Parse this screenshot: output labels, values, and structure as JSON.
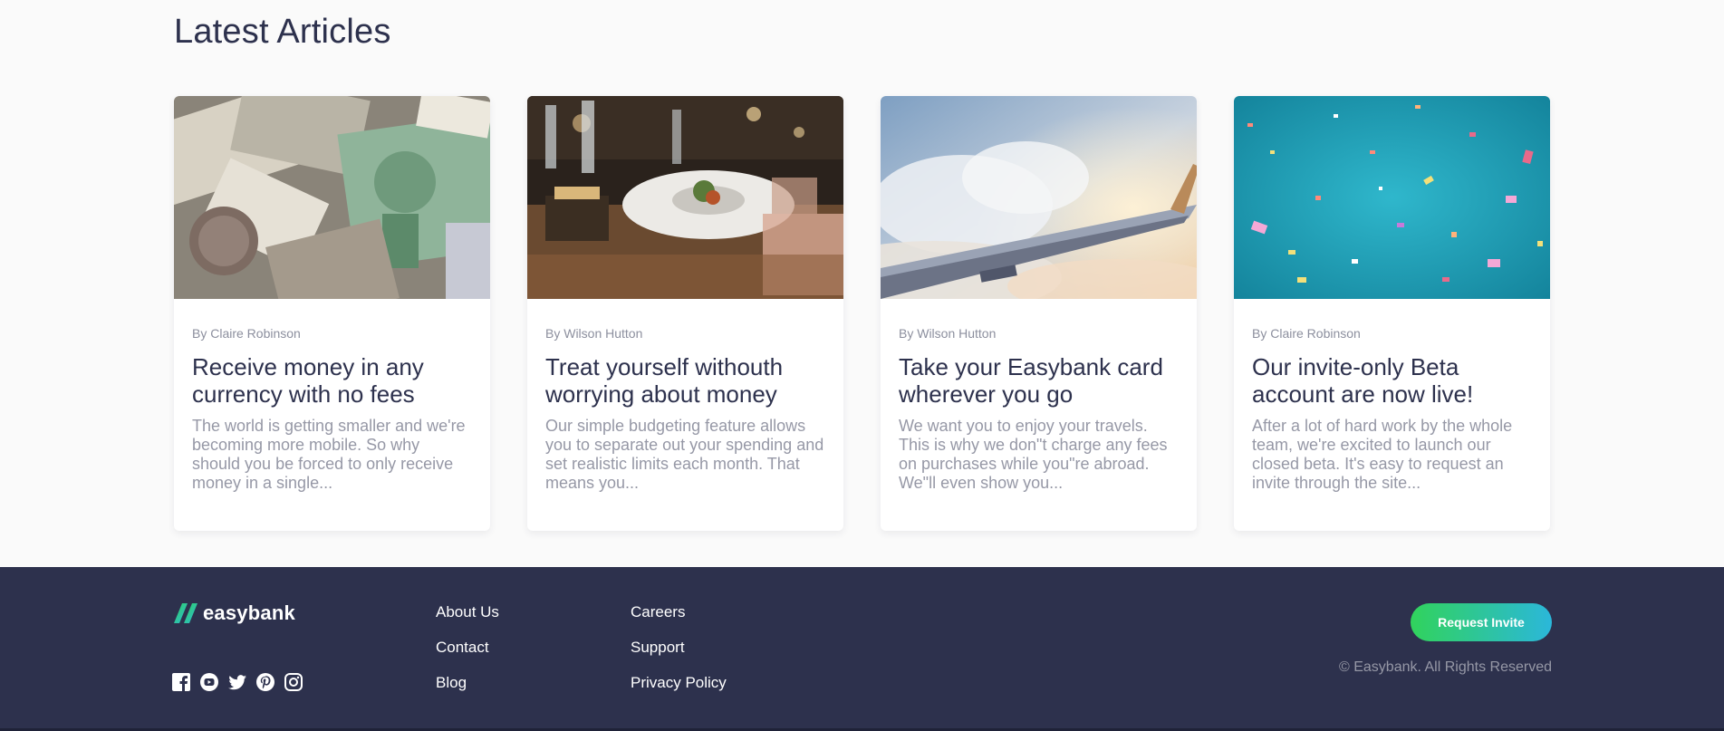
{
  "section_title": "Latest Articles",
  "articles": [
    {
      "author": "By Claire Robinson",
      "title": "Receive money in any currency with no fees",
      "excerpt": "The world is getting smaller and we're becoming more mobile. So why should you be forced to only receive money in a single..."
    },
    {
      "author": "By Wilson Hutton",
      "title": "Treat yourself withouth worrying about money",
      "excerpt": "Our simple budgeting feature allows you to separate out your spending and set realistic limits each month. That means you..."
    },
    {
      "author": "By Wilson Hutton",
      "title": "Take your Easybank card wherever you go",
      "excerpt": "We want you to enjoy your travels. This is why we don\"t charge any fees on purchases while you\"re abroad. We\"ll even show you..."
    },
    {
      "author": "By Claire Robinson",
      "title": "Our invite-only Beta account are now live!",
      "excerpt": "After a lot of hard work by the whole team, we're excited to launch our closed beta. It's easy to request an invite through the site..."
    }
  ],
  "footer": {
    "logo_text": "easybank",
    "links_col1": [
      "About Us",
      "Contact",
      "Blog"
    ],
    "links_col2": [
      "Careers",
      "Support",
      "Privacy Policy"
    ],
    "cta_label": "Request Invite",
    "copyright": "© Easybank. All Rights Reserved",
    "social_icons": [
      "facebook-icon",
      "youtube-icon",
      "twitter-icon",
      "pinterest-icon",
      "instagram-icon"
    ]
  },
  "colors": {
    "dark_blue": "#2d314d",
    "lime_green": "#31d35c",
    "bright_cyan": "#2bb7da",
    "grayish_blue": "#9698a6",
    "page_bg": "#fafafa"
  }
}
